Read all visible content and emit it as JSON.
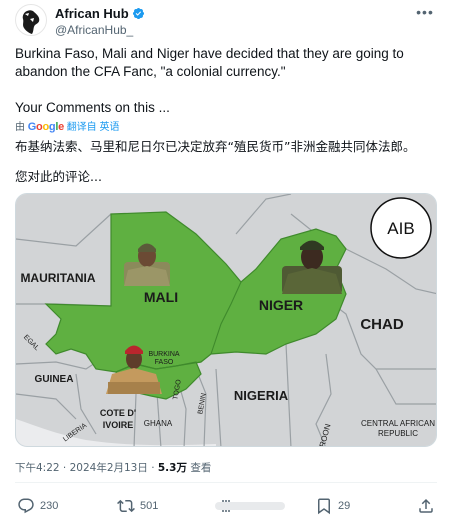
{
  "author": {
    "display_name": "African Hub",
    "handle": "@AfricanHub_",
    "verified": true
  },
  "tweet": {
    "lines": [
      "Burkina Faso, Mali and Niger have decided that they are going to",
      "abandon the CFA Fanc, \"a colonial currency.\""
    ],
    "comment_line": "Your Comments on this ..."
  },
  "translation": {
    "prefix": "由",
    "brand": "Google",
    "label": "翻译自 英语"
  },
  "translated_text": {
    "line1": "布基纳法索、马里和尼日尔已决定放弃“殖民货币”非洲金融共同体法郎。",
    "line2": "您对此的评论..."
  },
  "map": {
    "badge": "AIB",
    "labels": {
      "mauritania": "MAURITANIA",
      "mali": "MALI",
      "niger": "NIGER",
      "chad": "CHAD",
      "burkina_faso_1": "BURKINA",
      "burkina_faso_2": "FASO",
      "nigeria": "NIGERIA",
      "guinea": "GUINEA",
      "cote_1": "COTE D'",
      "cote_2": "IVOIRE",
      "ghana": "GHANA",
      "togo": "TOGO",
      "benin": "BENIN",
      "liberia": "LIBERIA",
      "senegal": "EGAL",
      "cameroon": "MEROON",
      "car_1": "CENTRAL AFRICAN",
      "car_2": "REPUBLIC"
    },
    "colors": {
      "highlight": "#5fb041",
      "land": "#d2d4d6",
      "sea": "#ebecee",
      "border": "#9aa0a4"
    }
  },
  "meta": {
    "time": "下午4:22 · 2024年2月13日 · ",
    "views_count": "5.3万",
    "views_label": " 查看"
  },
  "actions": {
    "replies": "230",
    "reposts": "501",
    "bookmarks": "29"
  }
}
